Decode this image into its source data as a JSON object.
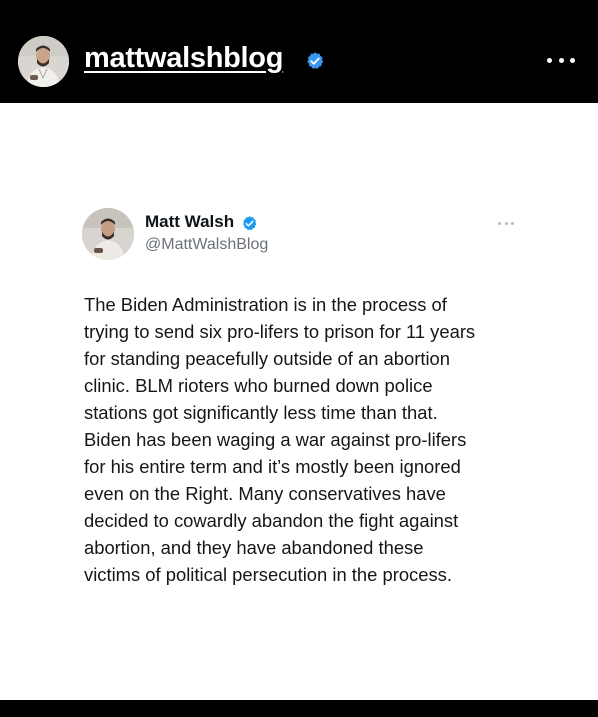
{
  "header": {
    "username": "mattwalshblog",
    "verified_color": "#3897f0",
    "more_icon": "more-horizontal-icon"
  },
  "tweet": {
    "display_name": "Matt Walsh",
    "handle": "@MattWalshBlog",
    "verified_color": "#1d9bf0",
    "body_lines": [
      "The Biden Administration is in the process of",
      "trying to send six pro-lifers to prison for 11 years",
      "for standing peacefully outside of an abortion",
      "clinic. BLM rioters who burned down police",
      "stations got significantly less time than that.",
      "Biden has been waging a war against pro-lifers",
      "for his entire term and it’s mostly been ignored",
      "even on the Right. Many conservatives have",
      "decided to cowardly abandon the fight against",
      "abortion, and they have abandoned these",
      "victims of political persecution in the process."
    ]
  }
}
